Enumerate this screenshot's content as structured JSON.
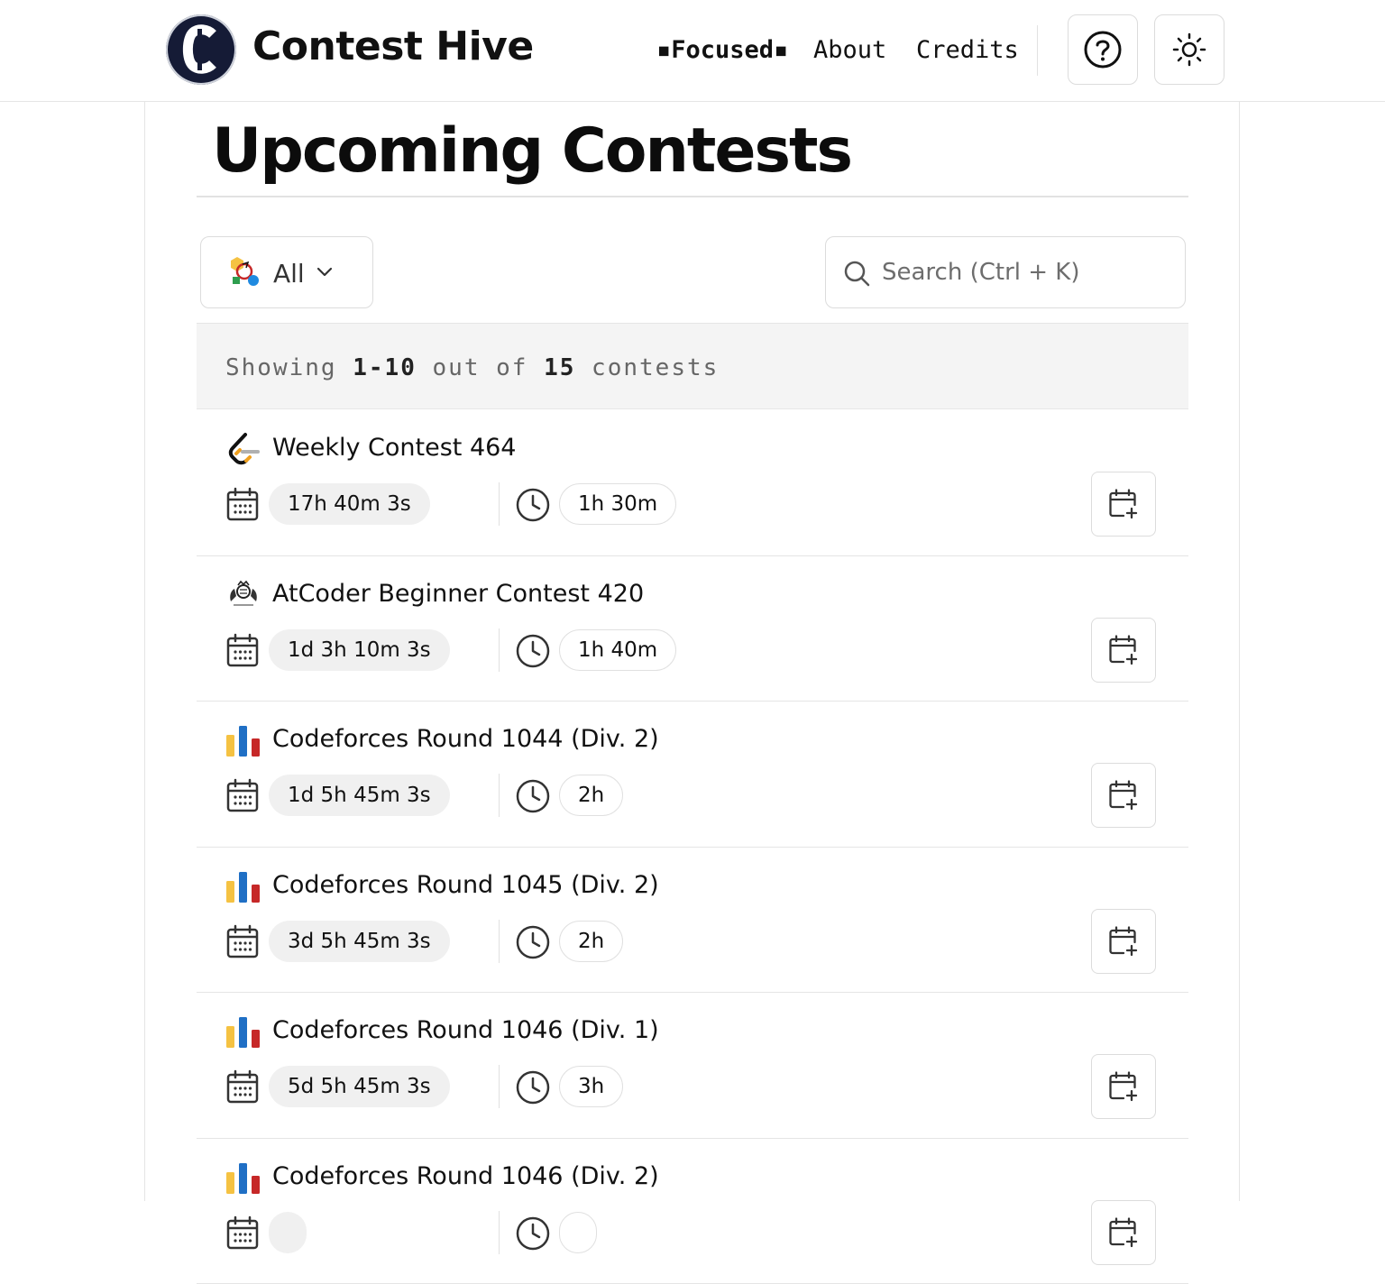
{
  "header": {
    "brand": "Contest Hive",
    "logo_letter": "C",
    "nav": {
      "focused": "▪Focused▪",
      "about": "About",
      "credits": "Credits"
    },
    "help_icon": "question-circle-icon",
    "theme_icon": "sun-icon"
  },
  "page_title": "Upcoming Contests",
  "filter": {
    "label": "All",
    "icon": "all-platforms-icon"
  },
  "search": {
    "placeholder": "Search (Ctrl + K)"
  },
  "showing": {
    "prefix": "Showing ",
    "range": "1-10",
    "middle": " out of ",
    "total": "15",
    "suffix": " contests"
  },
  "contests": [
    {
      "platform": "leetcode",
      "name": "Weekly Contest 464",
      "starts_in": "17h 40m 3s",
      "duration": "1h 30m"
    },
    {
      "platform": "atcoder",
      "name": "AtCoder Beginner Contest 420",
      "starts_in": "1d 3h 10m 3s",
      "duration": "1h 40m"
    },
    {
      "platform": "codeforces",
      "name": "Codeforces Round 1044 (Div. 2)",
      "starts_in": "1d 5h 45m 3s",
      "duration": "2h"
    },
    {
      "platform": "codeforces",
      "name": "Codeforces Round 1045 (Div. 2)",
      "starts_in": "3d 5h 45m 3s",
      "duration": "2h"
    },
    {
      "platform": "codeforces",
      "name": "Codeforces Round 1046 (Div. 1)",
      "starts_in": "5d 5h 45m 3s",
      "duration": "3h"
    },
    {
      "platform": "codeforces",
      "name": "Codeforces Round 1046 (Div. 2)"
    }
  ],
  "colors": {
    "codeforces_yellow": "#f5c242",
    "codeforces_blue": "#1f6fc5",
    "codeforces_red": "#c62828",
    "leetcode_orange": "#f0a01e",
    "logo_navy": "#151b36"
  }
}
